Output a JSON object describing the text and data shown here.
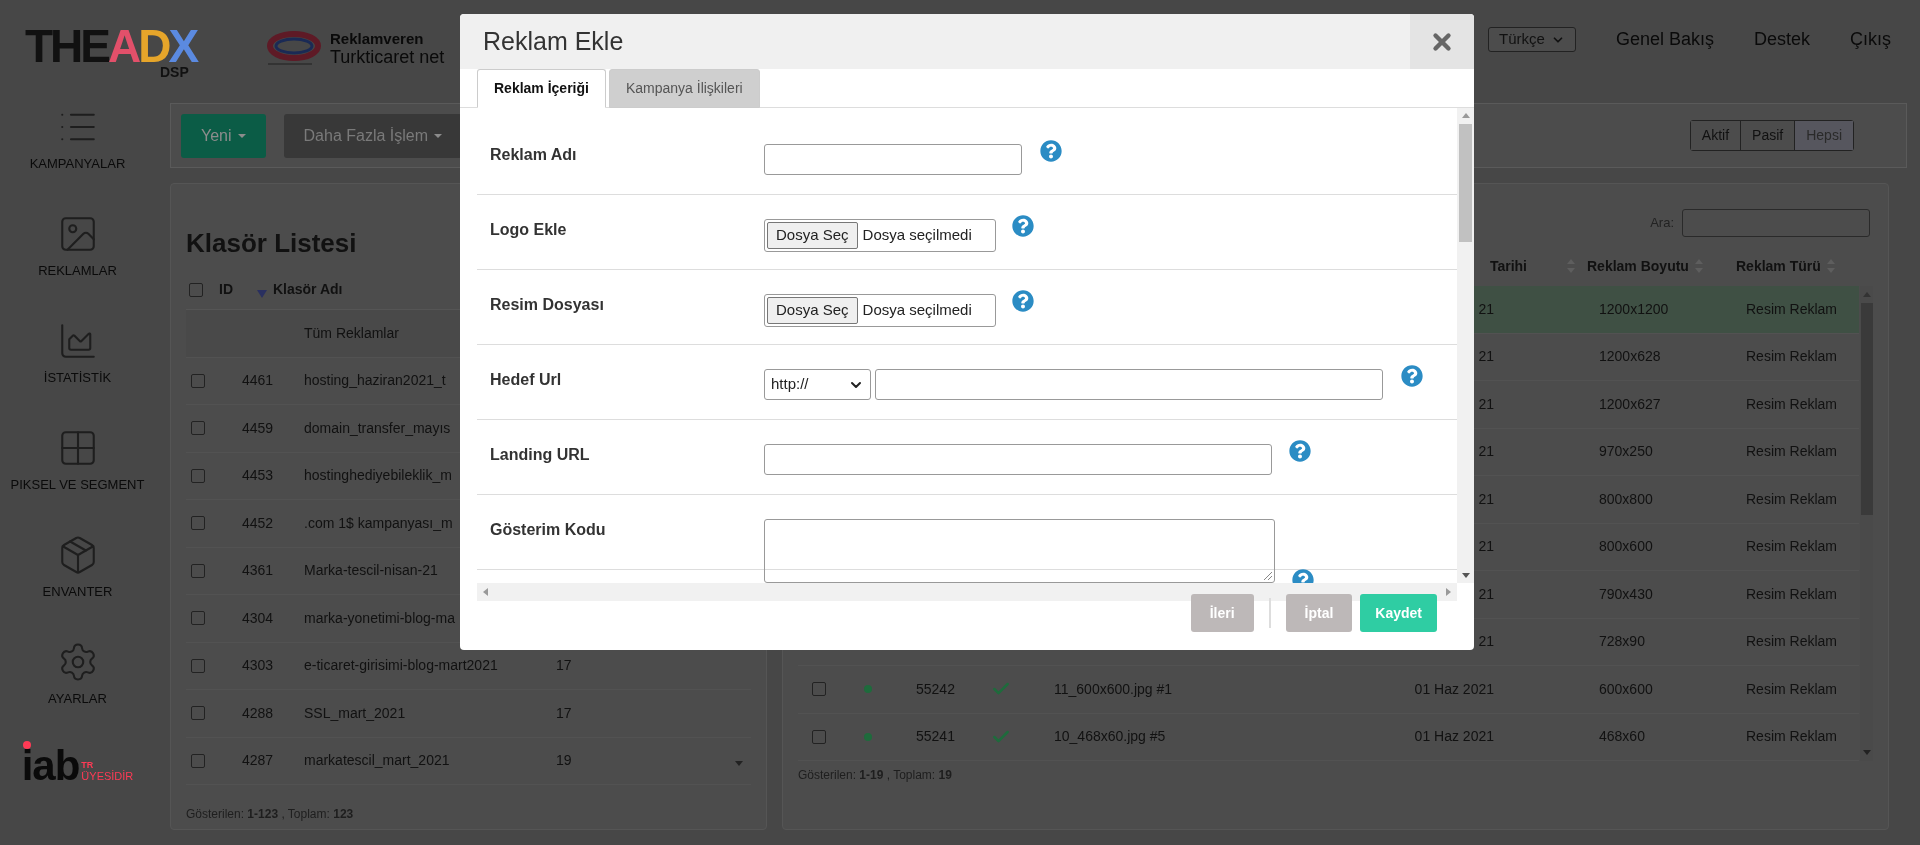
{
  "logo": {
    "parts": [
      {
        "text": "THE",
        "color": "#111111"
      },
      {
        "text": "A",
        "color": "#e2506a"
      },
      {
        "text": "D",
        "color": "#e6a52a"
      },
      {
        "text": "X",
        "color": "#5b8ae0"
      }
    ],
    "sub": "DSP"
  },
  "advertiser": {
    "label": "Reklamveren",
    "name": "Turkticaret net"
  },
  "top_nav": {
    "language": "Türkçe",
    "links": [
      "Genel Bakış",
      "Destek",
      "Çıkış"
    ]
  },
  "sidebar": {
    "items": [
      {
        "label": "KAMPANYALAR",
        "kind": "campaigns"
      },
      {
        "label": "REKLAMLAR",
        "kind": "ads"
      },
      {
        "label": "İSTATİSTİK",
        "kind": "stats"
      },
      {
        "label": "PIKSEL VE SEGMENT",
        "kind": "pixel"
      },
      {
        "label": "ENVANTER",
        "kind": "inventory"
      },
      {
        "label": "AYARLAR",
        "kind": "settings"
      }
    ]
  },
  "iab": {
    "mark": "iab",
    "country": "TR",
    "text": "ÜYESİDİR"
  },
  "toolbar": {
    "buttons": [
      {
        "label": "Yeni",
        "kind": "primary"
      },
      {
        "label": "Daha Fazla İşlem",
        "kind": "dark"
      }
    ],
    "filters": [
      {
        "label": "Aktif",
        "selected": false
      },
      {
        "label": "Pasif",
        "selected": false
      },
      {
        "label": "Hepsi",
        "selected": true
      }
    ]
  },
  "folder_list": {
    "title": "Klasör Listesi",
    "select_all": {
      "checked": false
    },
    "columns": [
      "ID",
      "Klasör Adı"
    ],
    "rows": [
      {
        "kind": "all",
        "name": "Tüm Reklamlar"
      },
      {
        "kind": "folder",
        "checked": false,
        "id": "4461",
        "name": "hosting_haziran2021_t"
      },
      {
        "kind": "folder",
        "checked": false,
        "id": "4459",
        "name": "domain_transfer_mayıs"
      },
      {
        "kind": "folder",
        "checked": false,
        "id": "4453",
        "name": "hostinghediyebileklik_m"
      },
      {
        "kind": "folder",
        "checked": false,
        "id": "4452",
        "name": ".com 1$ kampanyası_m"
      },
      {
        "kind": "folder",
        "checked": false,
        "id": "4361",
        "name": "Marka-tescil-nisan-21"
      },
      {
        "kind": "folder",
        "checked": false,
        "id": "4304",
        "name": "marka-yonetimi-blog-ma"
      },
      {
        "kind": "folder",
        "checked": false,
        "id": "4303",
        "name": "e-ticaret-girisimi-blog-mart2021",
        "count": "17"
      },
      {
        "kind": "folder",
        "checked": false,
        "id": "4288",
        "name": "SSL_mart_2021",
        "count": "17"
      },
      {
        "kind": "folder",
        "checked": false,
        "id": "4287",
        "name": "markatescil_mart_2021",
        "count": "19"
      }
    ],
    "footer": "Gösterilen: **1-123** , Toplam: **123**"
  },
  "ads_table": {
    "search_label": "Ara:",
    "columns": [
      "Tarihi",
      "Reklam Boyutu",
      "Reklam Türü"
    ],
    "rows": [
      {
        "selected": true,
        "date": "21",
        "size": "1200x1200",
        "type": "Resim Reklam"
      },
      {
        "selected": false,
        "date": "21",
        "size": "1200x628",
        "type": "Resim Reklam"
      },
      {
        "selected": false,
        "date": "21",
        "size": "1200x627",
        "type": "Resim Reklam"
      },
      {
        "selected": false,
        "date": "21",
        "size": "970x250",
        "type": "Resim Reklam"
      },
      {
        "selected": false,
        "date": "21",
        "size": "800x800",
        "type": "Resim Reklam"
      },
      {
        "selected": false,
        "date": "21",
        "size": "800x600",
        "type": "Resim Reklam"
      },
      {
        "selected": false,
        "date": "21",
        "size": "790x430",
        "type": "Resim Reklam"
      },
      {
        "selected": false,
        "date": "21",
        "size": "728x90",
        "type": "Resim Reklam"
      },
      {
        "selected": false,
        "checked": false,
        "color": "#1e6b3c",
        "approved": true,
        "id": "55242",
        "name": "11_600x600.jpg #1",
        "date": "01 Haz 2021",
        "size": "600x600",
        "type": "Resim Reklam"
      },
      {
        "selected": false,
        "checked": false,
        "color": "#1e6b3c",
        "approved": true,
        "id": "55241",
        "name": "10_468x60.jpg #5",
        "date": "01 Haz 2021",
        "size": "468x60",
        "type": "Resim Reklam"
      }
    ],
    "footer": "Gösterilen: **1-19** , Toplam: **19**"
  },
  "modal": {
    "title": "Reklam Ekle",
    "tabs": [
      {
        "label": "Reklam İçeriği",
        "selected": true
      },
      {
        "label": "Kampanya İlişkileri",
        "selected": false
      }
    ],
    "fields": [
      {
        "label": "Reklam Adı",
        "kind": "short_text"
      },
      {
        "label": "Logo Ekle",
        "kind": "file",
        "button": "Dosya Seç",
        "status": "Dosya seçilmedi"
      },
      {
        "label": "Resim Dosyası",
        "kind": "file",
        "button": "Dosya Seç",
        "status": "Dosya seçilmedi"
      },
      {
        "label": "Hedef Url",
        "kind": "url",
        "protocol": "http://"
      },
      {
        "label": "Landing URL",
        "kind": "long_text"
      },
      {
        "label": "Gösterim Kodu",
        "kind": "textarea"
      }
    ],
    "buttons": [
      {
        "label": "İleri",
        "kind": "secondary"
      },
      {
        "label": "İptal",
        "kind": "secondary"
      },
      {
        "label": "Kaydet",
        "kind": "primary"
      }
    ]
  }
}
